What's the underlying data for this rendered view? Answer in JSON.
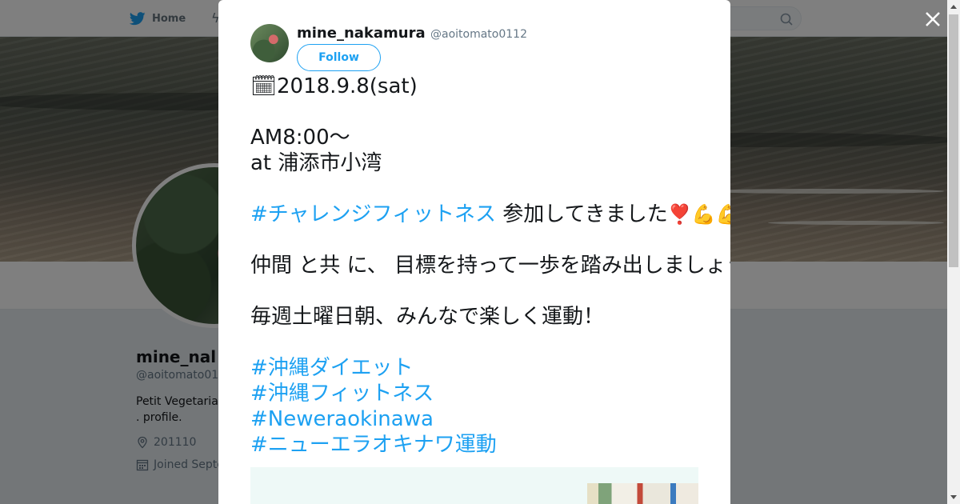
{
  "page": {
    "nav": {
      "home_label": "Home"
    }
  },
  "profile": {
    "name": "mine_nal",
    "handle": "@aoitomato01",
    "bio_line1": "Petit Vegetaria",
    "bio_line2": ". profile.",
    "location": "201110",
    "joined": "Joined Septe"
  },
  "tweet": {
    "author_name": "mine_nakamura",
    "author_handle": "@aoitomato0112",
    "follow_label": "Follow",
    "lines": {
      "l1": "🗓2018.9.8(sat)",
      "l2": "AM8:00〜",
      "l3": "at 浦添市小湾",
      "l4_tag": "#チャレンジフィットネス",
      "l4_text": " 参加してきました",
      "l4_emoji": "❣️💪💪",
      "l5_text": "仲間 と共 に、 目標を持って一歩を踏み出しましょう！",
      "l5_emoji": "🙋‍♀️",
      "l6": "毎週土曜日朝、みんなで楽しく運動！",
      "tag1": "#沖縄ダイエット",
      "tag2": "#沖縄フィットネス",
      "tag3": "#Neweraokinawa",
      "tag4": "#ニューエラオキナワ運動"
    }
  },
  "colors": {
    "accent": "#1da1f2",
    "text": "#14171a",
    "muted": "#657786"
  },
  "icons": {
    "close": "close-icon",
    "search": "search-icon",
    "bird": "twitter-bird-icon",
    "location": "location-pin-icon",
    "calendar": "calendar-icon"
  }
}
